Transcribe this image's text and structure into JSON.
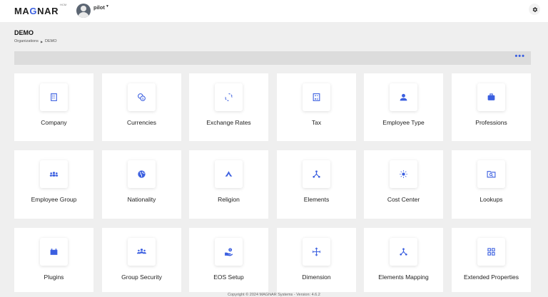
{
  "header": {
    "logo": {
      "pre": "MA",
      "accent": "G",
      "post": "NAR",
      "suffix": "HCM"
    },
    "user_name": "pilot",
    "accent_color": "#3b5fe0"
  },
  "page": {
    "title": "DEMO",
    "breadcrumb": [
      "Organizations",
      "DEMO"
    ],
    "more_label": "•••"
  },
  "cards": [
    {
      "label": "Company",
      "icon": "building-grid-icon"
    },
    {
      "label": "Currencies",
      "icon": "coins-icon"
    },
    {
      "label": "Exchange Rates",
      "icon": "exchange-circle-icon"
    },
    {
      "label": "Tax",
      "icon": "tax-calculator-icon"
    },
    {
      "label": "Employee Type",
      "icon": "person-icon"
    },
    {
      "label": "Professions",
      "icon": "briefcase-icon"
    },
    {
      "label": "Employee Group",
      "icon": "people-group-icon"
    },
    {
      "label": "Nationality",
      "icon": "globe-icon"
    },
    {
      "label": "Religion",
      "icon": "religion-icon"
    },
    {
      "label": "Elements",
      "icon": "hub-nodes-icon"
    },
    {
      "label": "Cost Center",
      "icon": "center-focus-icon"
    },
    {
      "label": "Lookups",
      "icon": "folder-search-icon"
    },
    {
      "label": "Plugins",
      "icon": "battery-plug-icon"
    },
    {
      "label": "Group Security",
      "icon": "group-security-icon"
    },
    {
      "label": "EOS Setup",
      "icon": "hand-coin-icon"
    },
    {
      "label": "Dimension",
      "icon": "dimension-arrows-icon"
    },
    {
      "label": "Elements Mapping",
      "icon": "mapping-nodes-icon"
    },
    {
      "label": "Extended Properties",
      "icon": "grid-squares-icon"
    }
  ],
  "footer": {
    "text": "Copyright © 2024 MAGNAR Systems - Version: 4.6.2"
  }
}
